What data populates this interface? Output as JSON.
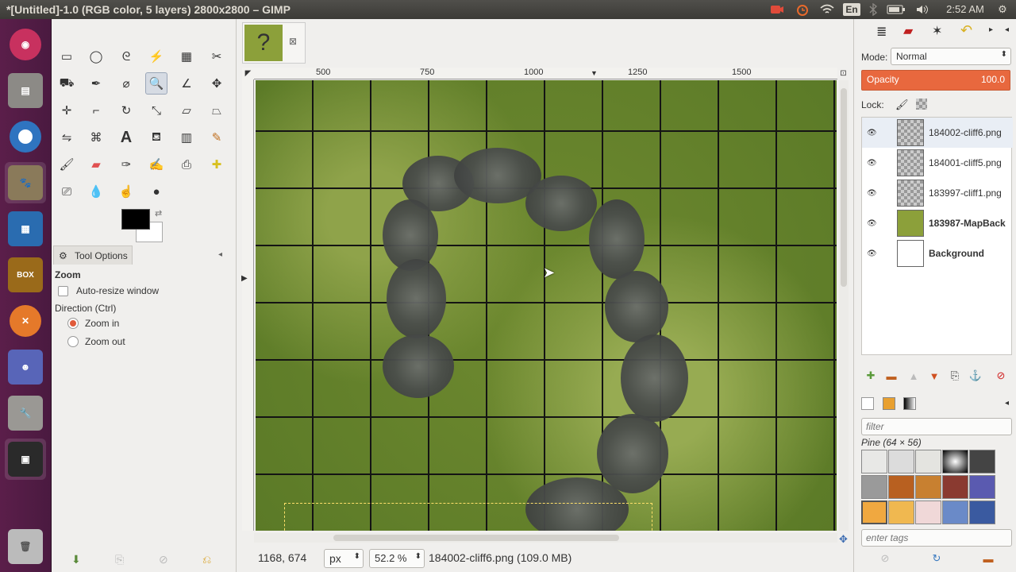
{
  "window_title": "*[Untitled]-1.0 (RGB color, 5 layers) 2800x2800 – GIMP",
  "tray": {
    "lang": "En",
    "time": "2:52 AM"
  },
  "toolbox": {
    "tool_options_tab": "Tool Options",
    "tool_name": "Zoom",
    "auto_resize": "Auto-resize window",
    "direction": "Direction  (Ctrl)",
    "zoom_in": "Zoom in",
    "zoom_out": "Zoom out"
  },
  "canvas": {
    "image_tab_glyph": "?",
    "ruler": [
      "500",
      "750",
      "1000",
      "1250",
      "1500"
    ]
  },
  "status": {
    "coords": "1168, 674",
    "unit": "px",
    "zoom": "52.2 %",
    "info": "184002-cliff6.png (109.0 MB)"
  },
  "layers": {
    "mode_label": "Mode:",
    "mode_value": "Normal",
    "opacity_label": "Opacity",
    "opacity_value": "100.0",
    "lock_label": "Lock:",
    "items": [
      {
        "name": "184002-cliff6.png"
      },
      {
        "name": "184001-cliff5.png"
      },
      {
        "name": "183997-cliff1.png"
      },
      {
        "name": "183987-MapBack"
      },
      {
        "name": "Background"
      }
    ]
  },
  "patterns": {
    "filter_placeholder": "filter",
    "selected": "Pine (64 × 56)",
    "tags_placeholder": "enter tags"
  },
  "colors": {
    "opacity_bar": "#e8683e",
    "launcher": "#5b1e4a"
  }
}
